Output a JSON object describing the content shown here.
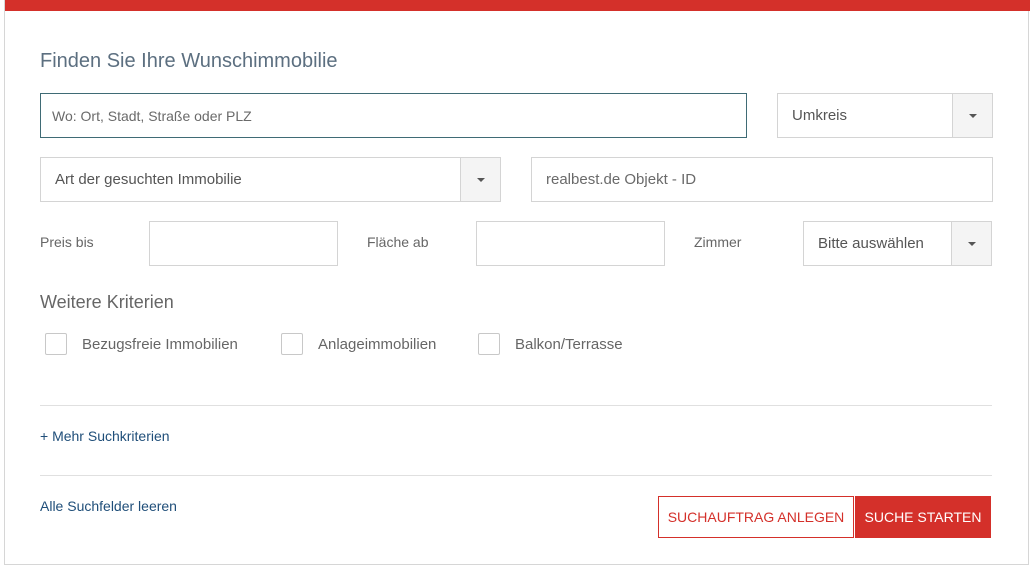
{
  "colors": {
    "accent": "#d4302a",
    "input_focus_border": "#3f6b75",
    "link": "#1f4e79"
  },
  "form": {
    "title": "Finden Sie Ihre Wunschimmobilie",
    "location_input": {
      "value": "",
      "placeholder": "Wo: Ort, Stadt, Straße oder PLZ"
    },
    "radius_select": {
      "selected": "Umkreis"
    },
    "property_type_select": {
      "selected": "Art der gesuchten Immobilie"
    },
    "object_id_input": {
      "value": "",
      "placeholder": "realbest.de Objekt - ID"
    },
    "price_label": "Preis bis",
    "price_input": {
      "value": ""
    },
    "area_label": "Fläche ab",
    "area_input": {
      "value": ""
    },
    "rooms_label": "Zimmer",
    "rooms_select": {
      "selected": "Bitte auswählen"
    },
    "more_criteria_title": "Weitere Kriterien",
    "checkboxes": [
      {
        "label": "Bezugsfreie Immobilien",
        "checked": false
      },
      {
        "label": "Anlageimmobilien",
        "checked": false
      },
      {
        "label": "Balkon/Terrasse",
        "checked": false
      }
    ],
    "more_search_link": "+ Mehr Suchkriterien",
    "clear_link": "Alle Suchfelder leeren",
    "save_search_button": "SUCHAUFTRAG ANLEGEN",
    "start_search_button": "SUCHE STARTEN"
  }
}
